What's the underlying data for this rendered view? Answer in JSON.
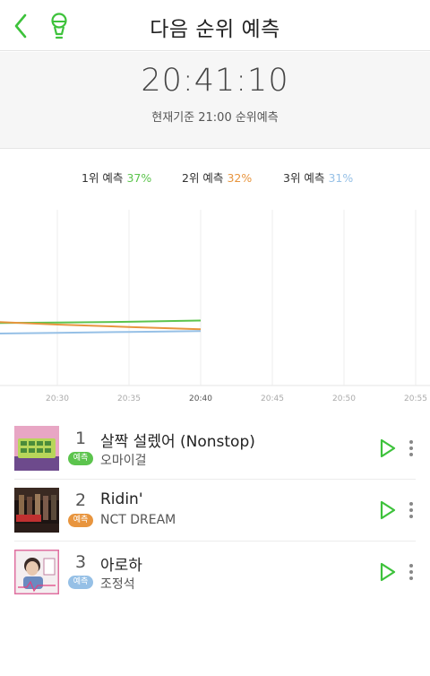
{
  "header": {
    "title": "다음 순위 예측",
    "back_icon": "chevron-left-icon",
    "mic_icon": "microphone-icon",
    "accent_color": "#3dc23b"
  },
  "time_panel": {
    "time": "20:41:10",
    "caption": "현재기준 21:00 순위예측"
  },
  "legend": [
    {
      "label": "1위 예측",
      "percent": "37%",
      "color": "#5cc44d"
    },
    {
      "label": "2위 예측",
      "percent": "32%",
      "color": "#e8953e"
    },
    {
      "label": "3위 예측",
      "percent": "31%",
      "color": "#96c0e6"
    }
  ],
  "chart_data": {
    "type": "line",
    "x": [
      "20:25",
      "20:30",
      "20:35",
      "20:40"
    ],
    "x_ticks": [
      "20:30",
      "20:35",
      "20:40",
      "20:45",
      "20:50",
      "20:55"
    ],
    "x_range": [
      "20:26",
      "20:56"
    ],
    "current_tick": "20:40",
    "ylim": [
      0,
      100
    ],
    "grid": true,
    "series": [
      {
        "name": "1위 예측",
        "color": "#5cc44d",
        "values": [
          35.5,
          35.8,
          36.3,
          37.0
        ]
      },
      {
        "name": "2위 예측",
        "color": "#e8953e",
        "values": [
          36.5,
          34.7,
          33.3,
          32.0
        ]
      },
      {
        "name": "3위 예측",
        "color": "#96c0e6",
        "values": [
          29.5,
          30.0,
          30.5,
          31.0
        ]
      }
    ]
  },
  "songs": [
    {
      "rank": "1",
      "title": "살짝 설렜어 (Nonstop)",
      "artist": "오마이걸",
      "badge": "예측",
      "badge_color": "#5cc44d"
    },
    {
      "rank": "2",
      "title": "Ridin'",
      "artist": "NCT DREAM",
      "badge": "예측",
      "badge_color": "#e8953e"
    },
    {
      "rank": "3",
      "title": "아로하",
      "artist": "조정석",
      "badge": "예측",
      "badge_color": "#96c0e6"
    }
  ]
}
